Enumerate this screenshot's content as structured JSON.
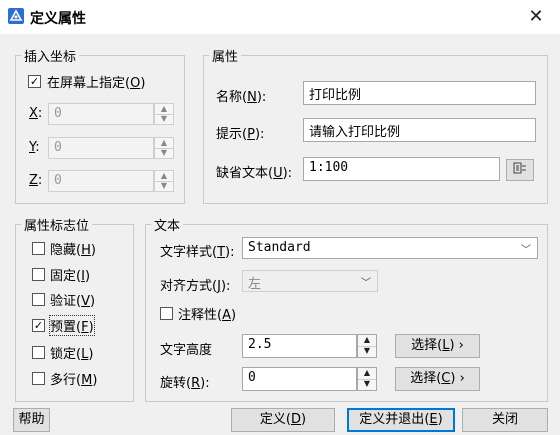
{
  "window": {
    "title": "定义属性",
    "close_glyph": "✕"
  },
  "insert_point": {
    "legend": "插入坐标",
    "specify_on_screen": {
      "label": "在屏幕上指定",
      "hotkey": "O",
      "checked": true
    },
    "fields": [
      {
        "name": "X",
        "value": "0"
      },
      {
        "name": "Y",
        "value": "0"
      },
      {
        "name": "Z",
        "value": "0"
      }
    ]
  },
  "attribute": {
    "legend": "属性",
    "name": {
      "label": "名称",
      "hotkey": "N",
      "value": "打印比例"
    },
    "prompt": {
      "label": "提示",
      "hotkey": "P",
      "value": "请输入打印比例"
    },
    "default": {
      "label": "缺省文本",
      "hotkey": "U",
      "value": "1:100",
      "icon": "field-insert-icon"
    }
  },
  "flags": {
    "legend": "属性标志位",
    "items": [
      {
        "label": "隐藏",
        "hotkey": "H",
        "checked": false
      },
      {
        "label": "固定",
        "hotkey": "I",
        "checked": false
      },
      {
        "label": "验证",
        "hotkey": "V",
        "checked": false
      },
      {
        "label": "预置",
        "hotkey": "F",
        "checked": true
      },
      {
        "label": "锁定",
        "hotkey": "L",
        "checked": false
      },
      {
        "label": "多行",
        "hotkey": "M",
        "checked": false
      }
    ]
  },
  "text": {
    "legend": "文本",
    "style": {
      "label": "文字样式",
      "hotkey": "T",
      "value": "Standard"
    },
    "justify": {
      "label": "对齐方式",
      "hotkey": "J",
      "value": "左"
    },
    "annotative": {
      "label": "注释性",
      "hotkey": "A",
      "checked": false
    },
    "height": {
      "label": "文字高度",
      "value": "2.5",
      "pick_label": "选择",
      "pick_hotkey": "L"
    },
    "rotation": {
      "label": "旋转",
      "hotkey": "R",
      "value": "0",
      "pick_label": "选择",
      "pick_hotkey": "C"
    }
  },
  "buttons": {
    "help": "帮助",
    "define": {
      "label": "定义",
      "hotkey": "D"
    },
    "define_exit": {
      "label": "定义并退出",
      "hotkey": "E"
    },
    "close": "关闭"
  }
}
